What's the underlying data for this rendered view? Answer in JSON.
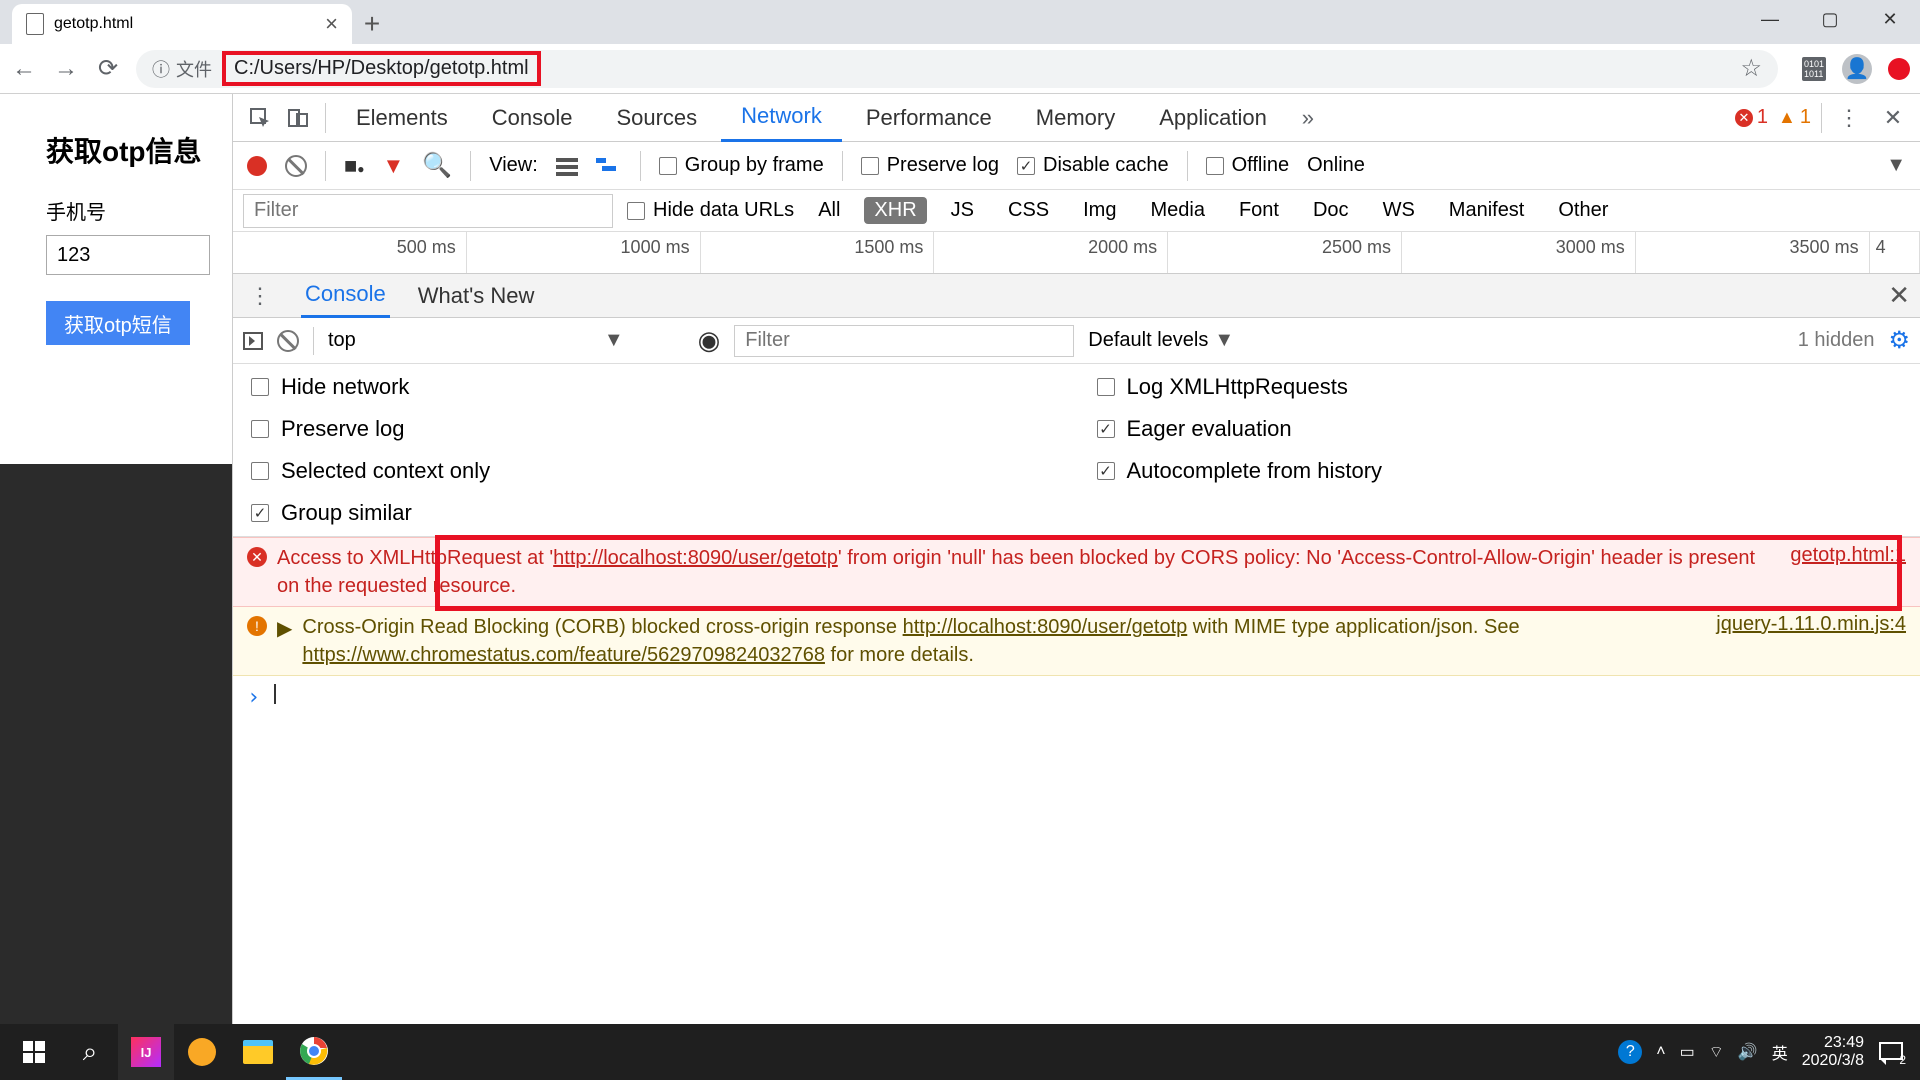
{
  "browser": {
    "tab_title": "getotp.html",
    "url_prefix": "文件",
    "url": "C:/Users/HP/Desktop/getotp.html"
  },
  "page": {
    "heading": "获取otp信息",
    "label": "手机号",
    "input_value": "123",
    "button": "获取otp短信"
  },
  "devtools": {
    "tabs": [
      "Elements",
      "Console",
      "Sources",
      "Network",
      "Performance",
      "Memory",
      "Application"
    ],
    "active_tab": "Network",
    "error_count": "1",
    "warn_count": "1",
    "network_bar": {
      "view_label": "View:",
      "group_by_frame": "Group by frame",
      "preserve_log": "Preserve log",
      "disable_cache": "Disable cache",
      "offline": "Offline",
      "online": "Online"
    },
    "filter": {
      "placeholder": "Filter",
      "hide_data_urls": "Hide data URLs",
      "types": [
        "All",
        "XHR",
        "JS",
        "CSS",
        "Img",
        "Media",
        "Font",
        "Doc",
        "WS",
        "Manifest",
        "Other"
      ],
      "active_type": "XHR"
    },
    "timeline": [
      "500 ms",
      "1000 ms",
      "1500 ms",
      "2000 ms",
      "2500 ms",
      "3000 ms",
      "3500 ms",
      "4"
    ],
    "drawer_tabs": [
      "Console",
      "What's New"
    ],
    "active_drawer": "Console",
    "console_bar": {
      "context": "top",
      "filter_placeholder": "Filter",
      "levels": "Default levels",
      "hidden": "1 hidden"
    },
    "console_opts": {
      "hide_network": "Hide network",
      "log_xhr": "Log XMLHttpRequests",
      "preserve_log": "Preserve log",
      "eager_eval": "Eager evaluation",
      "selected_context": "Selected context only",
      "autocomplete": "Autocomplete from history",
      "group_similar": "Group similar"
    },
    "messages": {
      "error_text_1": "Access to XMLHttpRequest at '",
      "error_url": "http://localhost:8090/user/getotp",
      "error_text_2": "' from origin 'null' has been blocked by CORS policy: No 'Access-Control-Allow-Origin' header is present on the requested resource.",
      "error_src": "getotp.html:1",
      "warn_text_1": "Cross-Origin Read Blocking (CORB) blocked cross-origin response ",
      "warn_url1": "http://localhost:8090/user/getotp",
      "warn_text_2": " with MIME type application/json. See ",
      "warn_url2": "https://www.chromestatus.com/feature/5629709824032768",
      "warn_text_3": " for more details.",
      "warn_src": "jquery-1.11.0.min.js:4"
    }
  },
  "taskbar": {
    "ime": "英",
    "time": "23:49",
    "date": "2020/3/8",
    "notif": "2"
  }
}
